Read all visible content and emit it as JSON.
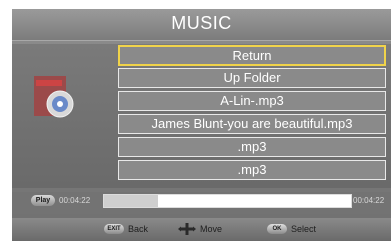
{
  "title": "MUSIC",
  "file_list": {
    "items": [
      {
        "label": "Return",
        "selected": true
      },
      {
        "label": "Up Folder",
        "selected": false
      },
      {
        "label": "A-Lin-.mp3",
        "selected": false
      },
      {
        "label": "James Blunt-you are beautiful.mp3",
        "selected": false
      },
      {
        "label": ".mp3",
        "selected": false
      },
      {
        "label": ".mp3",
        "selected": false
      }
    ]
  },
  "playback": {
    "play_label": "Play",
    "elapsed": "00:04:22",
    "total": "00:04:22",
    "progress_fraction": 0.22
  },
  "footer": {
    "back": {
      "key": "EXIT",
      "label": "Back"
    },
    "move": {
      "label": "Move"
    },
    "select": {
      "key": "OK",
      "label": "Select"
    }
  },
  "colors": {
    "selection_border": "#f0d34a"
  }
}
